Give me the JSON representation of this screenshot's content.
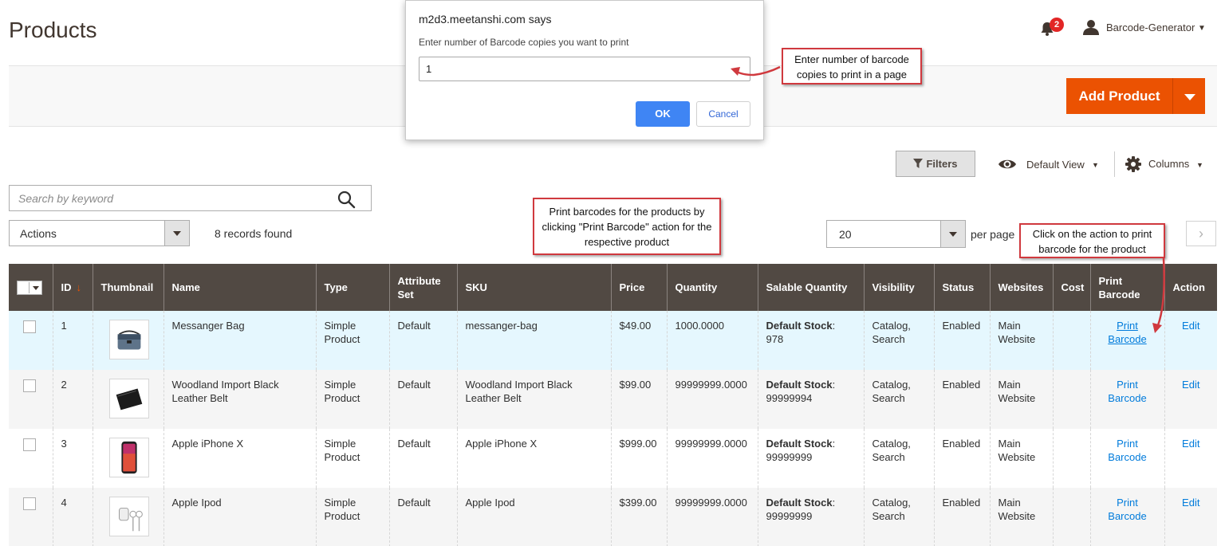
{
  "header": {
    "title": "Products",
    "notifications_count": "2",
    "user_name": "Barcode-Generator"
  },
  "page_actions": {
    "add_product": "Add Product"
  },
  "dialog": {
    "title": "m2d3.meetanshi.com says",
    "message": "Enter number of Barcode copies you want to print",
    "input_value": "1",
    "ok": "OK",
    "cancel": "Cancel"
  },
  "callouts": {
    "copies": "Enter number of barcode copies to print in a page",
    "print_barcodes": "Print barcodes for the products by clicking \"Print Barcode\" action for the respective product",
    "click_action": "Click on the action to print barcode for the product"
  },
  "toolbar": {
    "filters": "Filters",
    "view": "Default View",
    "columns": "Columns",
    "search_placeholder": "Search by keyword",
    "actions": "Actions",
    "records": "8 records found",
    "per_page_value": "20",
    "per_page_label": "per page",
    "next": "›"
  },
  "grid": {
    "columns": [
      "ID",
      "Thumbnail",
      "Name",
      "Type",
      "Attribute Set",
      "SKU",
      "Price",
      "Quantity",
      "Salable Quantity",
      "Visibility",
      "Status",
      "Websites",
      "Cost",
      "Print Barcode",
      "Action"
    ],
    "sort_indicator": "↓",
    "rows": [
      {
        "id": "1",
        "name": "Messanger Bag",
        "type": "Simple Product",
        "attribute_set": "Default",
        "sku": "messanger-bag",
        "price": "$49.00",
        "quantity": "1000.0000",
        "salable_label": "Default Stock",
        "salable_value": "978",
        "visibility": "Catalog, Search",
        "status": "Enabled",
        "websites": "Main Website",
        "cost": "",
        "print_barcode": "Print Barcode",
        "action": "Edit",
        "thumb_icon": "bag-icon"
      },
      {
        "id": "2",
        "name": "Woodland Import Black Leather Belt",
        "type": "Simple Product",
        "attribute_set": "Default",
        "sku": "Woodland Import Black Leather Belt",
        "price": "$99.00",
        "quantity": "99999999.0000",
        "salable_label": "Default Stock",
        "salable_value": "99999994",
        "visibility": "Catalog, Search",
        "status": "Enabled",
        "websites": "Main Website",
        "cost": "",
        "print_barcode": "Print Barcode",
        "action": "Edit",
        "thumb_icon": "wallet-icon"
      },
      {
        "id": "3",
        "name": "Apple iPhone X",
        "type": "Simple Product",
        "attribute_set": "Default",
        "sku": "Apple iPhone X",
        "price": "$999.00",
        "quantity": "99999999.0000",
        "salable_label": "Default Stock",
        "salable_value": "99999999",
        "visibility": "Catalog, Search",
        "status": "Enabled",
        "websites": "Main Website",
        "cost": "",
        "print_barcode": "Print Barcode",
        "action": "Edit",
        "thumb_icon": "phone-icon"
      },
      {
        "id": "4",
        "name": "Apple Ipod",
        "type": "Simple Product",
        "attribute_set": "Default",
        "sku": "Apple Ipod",
        "price": "$399.00",
        "quantity": "99999999.0000",
        "salable_label": "Default Stock",
        "salable_value": "99999999",
        "visibility": "Catalog, Search",
        "status": "Enabled",
        "websites": "Main Website",
        "cost": "",
        "print_barcode": "Print Barcode",
        "action": "Edit",
        "thumb_icon": "earphones-icon"
      }
    ]
  },
  "colors": {
    "accent": "#eb5202",
    "header_bg": "#514943",
    "link": "#007bdb",
    "callout_border": "#d0393e",
    "dialog_ok": "#3f85f4"
  }
}
